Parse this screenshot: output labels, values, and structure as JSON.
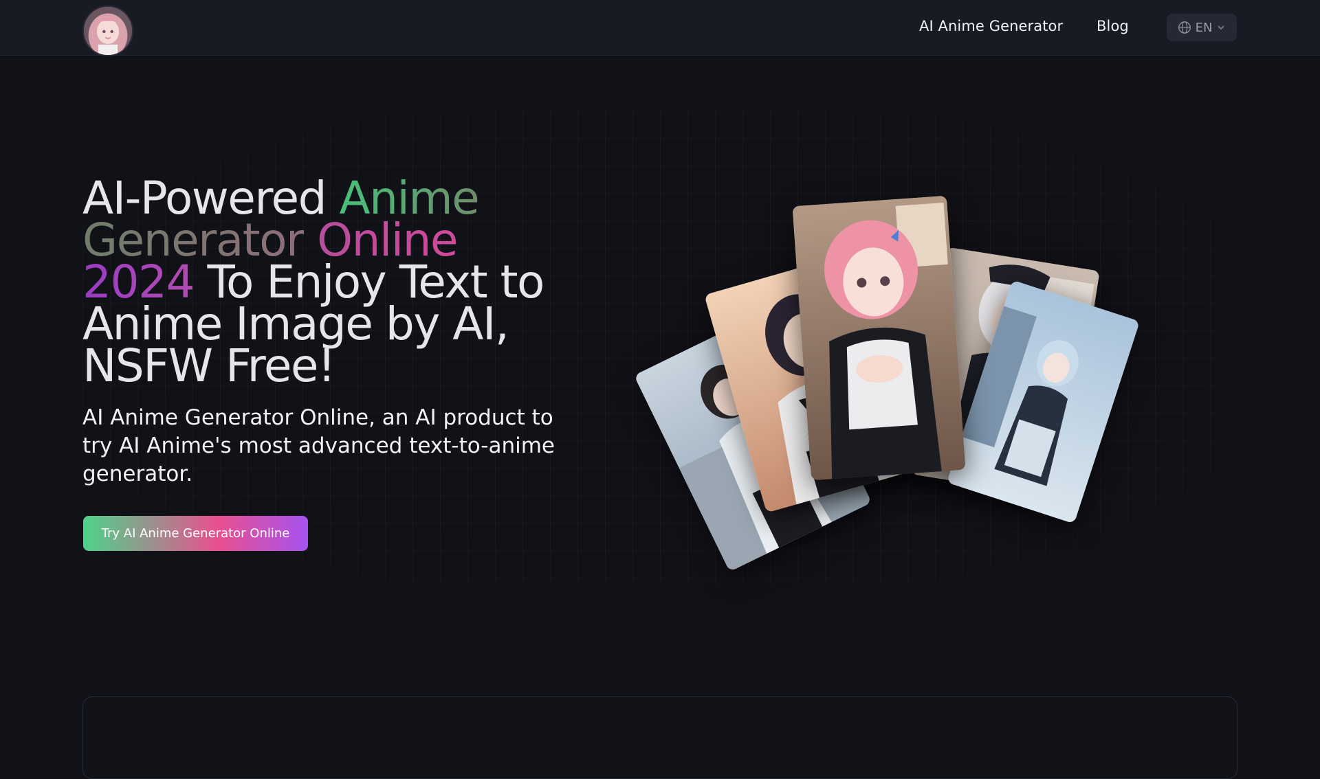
{
  "header": {
    "logo_icon": "anime-avatar-logo",
    "nav": [
      {
        "label": "AI Anime Generator"
      },
      {
        "label": "Blog"
      }
    ],
    "language": {
      "icon": "globe-icon",
      "value": "EN",
      "caret_icon": "chevron-down-icon"
    }
  },
  "hero": {
    "headline": {
      "part1": "AI-Powered ",
      "part2": "Anime",
      "part3": "Generator",
      "part4": " Online",
      "part5": "2024",
      "part6": " To Enjoy Text to Anime Image by AI, NSFW Free!"
    },
    "subtext": "AI Anime Generator Online, an AI product to try AI Anime's most advanced text-to-anime generator.",
    "cta_label": "Try AI Anime Generator Online",
    "gallery_cards": [
      {
        "name": "anime-card-street-girl"
      },
      {
        "name": "anime-card-dark-hair-girl"
      },
      {
        "name": "anime-card-pink-hair-maid"
      },
      {
        "name": "anime-card-white-hair-maid"
      },
      {
        "name": "anime-card-blue-hair-girl"
      }
    ]
  },
  "colors": {
    "background": "#111118",
    "header": "#191b24",
    "accent_green": "#4ed38a",
    "accent_pink": "#e8508f",
    "accent_purple": "#a653f0"
  }
}
